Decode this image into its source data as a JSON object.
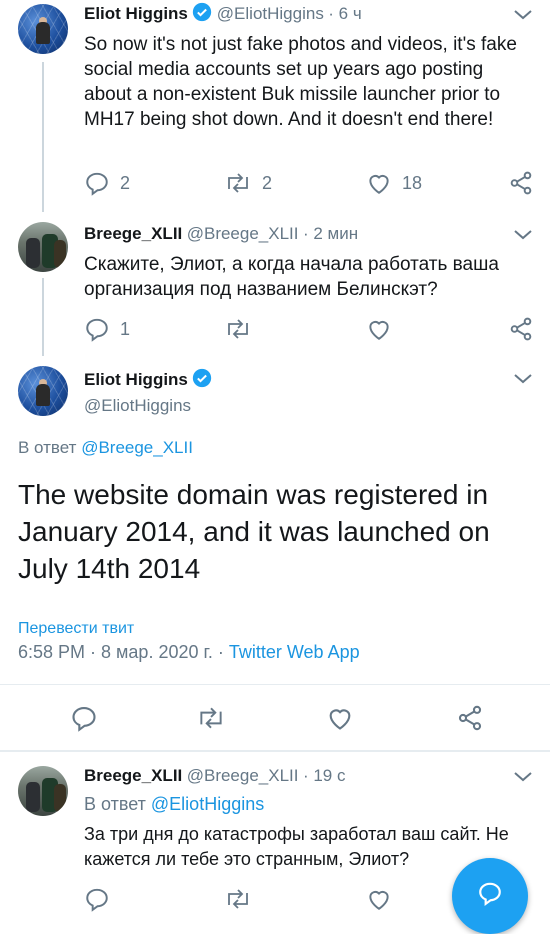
{
  "tweet1": {
    "name": "Eliot Higgins",
    "handle": "@EliotHiggins",
    "time": "· 6 ч",
    "text": "So now it's not just fake photos and videos, it's fake social media accounts set up years ago posting about a non-existent Buk missile launcher prior to MH17 being shot down. And it doesn't end there!",
    "replies": "2",
    "retweets": "2",
    "likes": "18"
  },
  "tweet2": {
    "name": "Breege_XLII",
    "handle": "@Breege_XLII",
    "time": "· 2 мин",
    "text": "Скажите, Элиот, а когда начала работать ваша организация под названием Белинскэт?",
    "replies": "1"
  },
  "main_tweet": {
    "name": "Eliot Higgins",
    "handle": "@EliotHiggins",
    "reply_prefix": "В ответ",
    "reply_to": "@Breege_XLII",
    "text": "The website domain was registered in January 2014, and it was launched on July 14th 2014",
    "translate": "Перевести твит",
    "timestamp": "6:58 PM · 8 мар. 2020 г. ·",
    "source": "Twitter Web App"
  },
  "tweet4": {
    "name": "Breege_XLII",
    "handle": "@Breege_XLII",
    "time": "· 19 с",
    "reply_prefix": "В ответ",
    "reply_to": "@EliotHiggins",
    "text": "За три дня до катастрофы заработал ваш сайт. Не кажется ли тебе это странным, Элиот?"
  },
  "colors": {
    "accent": "#1b95e0",
    "muted": "#657786",
    "verified": "#1da1f2"
  }
}
